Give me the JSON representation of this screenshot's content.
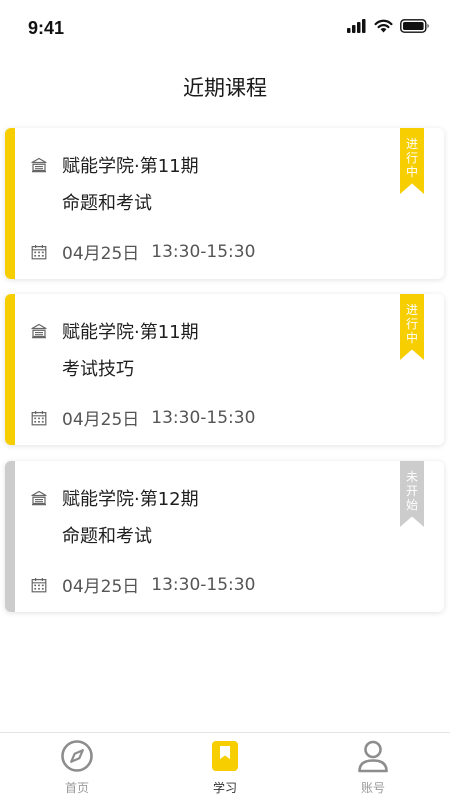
{
  "status_bar": {
    "time": "9:41",
    "icons": [
      "signal-icon",
      "wifi-icon",
      "battery-icon"
    ]
  },
  "page_title": "近期课程",
  "colors": {
    "active_accent": "#F7CE00",
    "inactive_accent": "#CCCCCC"
  },
  "courses": [
    {
      "institute": "赋能学院·第11期",
      "topic": "命题和考试",
      "date": "04月25日",
      "time": "13:30-15:30",
      "status": [
        "进",
        "行",
        "中"
      ],
      "state": "active"
    },
    {
      "institute": "赋能学院·第11期",
      "topic": "考试技巧",
      "date": "04月25日",
      "time": "13:30-15:30",
      "status": [
        "进",
        "行",
        "中"
      ],
      "state": "active"
    },
    {
      "institute": "赋能学院·第12期",
      "topic": "命题和考试",
      "date": "04月25日",
      "time": "13:30-15:30",
      "status": [
        "未",
        "开",
        "始"
      ],
      "state": "pending"
    }
  ],
  "tabbar": {
    "tabs": [
      {
        "label": "首页",
        "icon": "compass-icon"
      },
      {
        "label": "学习",
        "icon": "book-icon"
      },
      {
        "label": "账号",
        "icon": "user-icon"
      }
    ]
  }
}
